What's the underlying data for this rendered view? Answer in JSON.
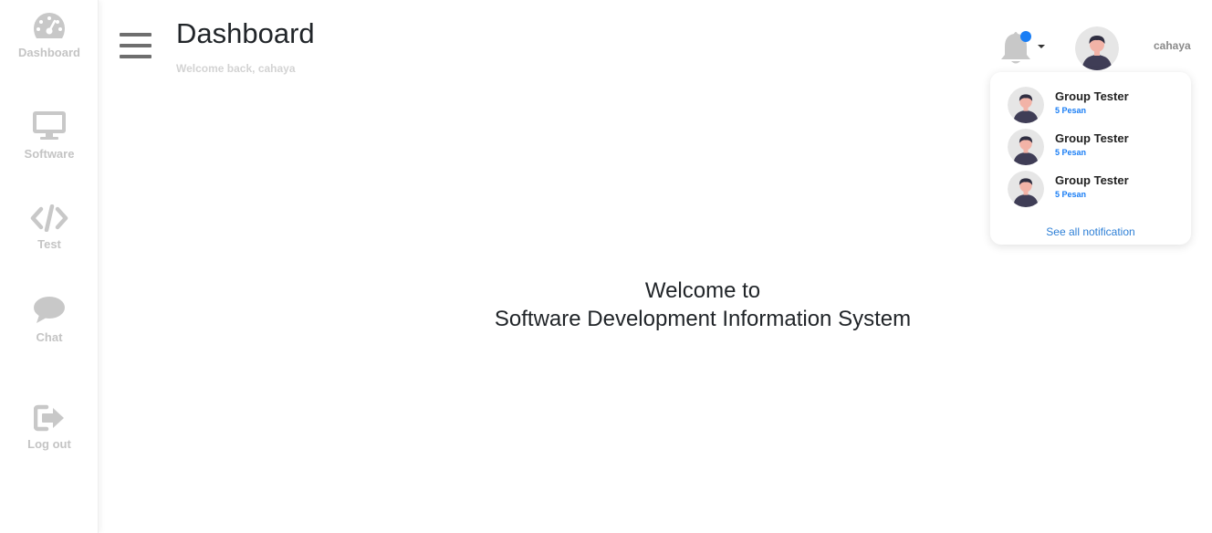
{
  "sidebar": {
    "items": [
      {
        "label": "Dashboard",
        "icon": "speedometer-icon"
      },
      {
        "label": "Software",
        "icon": "monitor-icon"
      },
      {
        "label": "Test",
        "icon": "code-icon"
      },
      {
        "label": "Chat",
        "icon": "chat-bubble-icon"
      },
      {
        "label": "Log out",
        "icon": "logout-icon"
      }
    ]
  },
  "header": {
    "title": "Dashboard",
    "subtitle": "Welcome back, cahaya",
    "username": "cahaya"
  },
  "notifications": {
    "items": [
      {
        "name": "Group Tester",
        "count": "5 Pesan"
      },
      {
        "name": "Group Tester",
        "count": "5 Pesan"
      },
      {
        "name": "Group Tester",
        "count": "5 Pesan"
      }
    ],
    "see_all": "See all notification"
  },
  "main": {
    "welcome_line1": "Welcome to",
    "welcome_line2": "Software Development Information System"
  },
  "colors": {
    "accent": "#1a7ef5",
    "sidebar_icon": "#c4c4c4",
    "link": "#2d7fd6"
  }
}
